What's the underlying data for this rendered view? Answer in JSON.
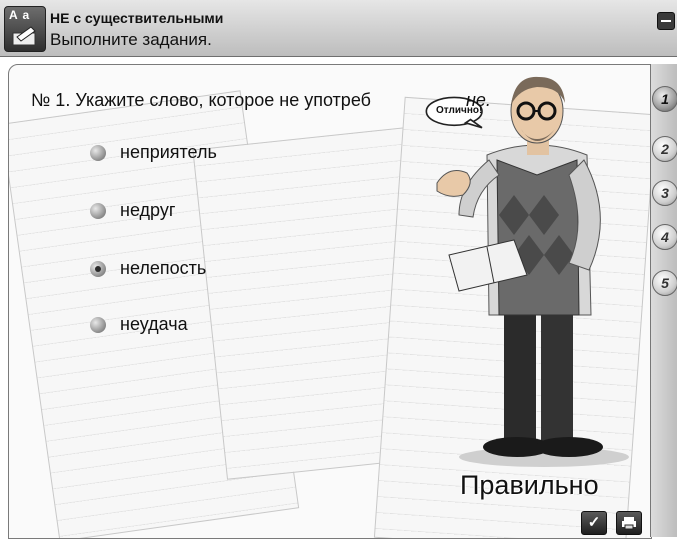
{
  "header": {
    "title": "НЕ с существительными",
    "subtitle": "Выполните задания.",
    "logo_label": "A a"
  },
  "question": {
    "prefix": "№ 1. Укажите слово, которое не употреб",
    "suffix": "не."
  },
  "options": [
    {
      "label": "неприятель",
      "selected": false
    },
    {
      "label": "недруг",
      "selected": false
    },
    {
      "label": "нелепость",
      "selected": true
    },
    {
      "label": "неудача",
      "selected": false
    }
  ],
  "speech_bubble": "Отлично!",
  "result": "Правильно",
  "task_numbers": [
    "1",
    "2",
    "3",
    "4",
    "5"
  ],
  "active_task": "1",
  "buttons": {
    "check_icon": "check-icon",
    "print_icon": "printer-icon"
  },
  "colors": {
    "header_bg": "#cfcfcf",
    "panel_bg": "#fafafa",
    "rail_bg": "#cccccc"
  }
}
